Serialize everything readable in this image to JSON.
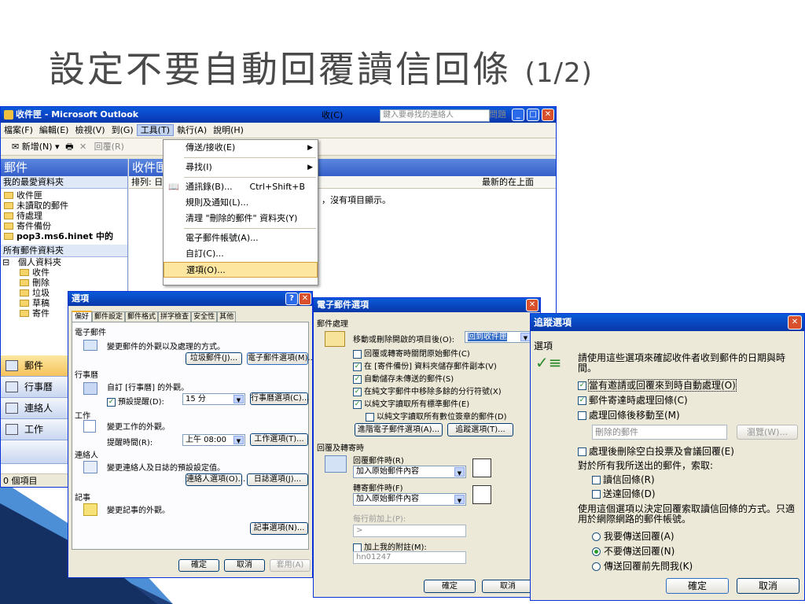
{
  "slide": {
    "title": "設定不要自動回覆讀信回條",
    "title_num": "(1/2)"
  },
  "outlook": {
    "title": "收件匣 - Microsoft Outlook",
    "menubar": [
      "檔案(F)",
      "編輯(E)",
      "檢視(V)",
      "到(G)",
      "工具(T)",
      "執行(A)",
      "說明(H)"
    ],
    "help_box": "輸入需要解答的問題",
    "toolbar": {
      "new": "新增(N)",
      "reply": "回覆(R)",
      "sendrecv": "收(C)",
      "contact_search": "鍵入要尋找的連絡人"
    },
    "nav_title": "郵件",
    "favorites": "我的最愛資料夾",
    "fav_items": [
      "收件匣",
      "未讀取的郵件",
      "待處理",
      "寄件備份",
      "pop3.ms6.hinet 中的 "
    ],
    "all_folders": "所有郵件資料夾",
    "personal": "個人資料夾",
    "sub_items": [
      "收件",
      "刪除",
      "垃圾",
      "草稿",
      "寄件"
    ],
    "nav_buttons": [
      "郵件",
      "行事曆",
      "連絡人",
      "工作"
    ],
    "status": "0 個項目",
    "pane_title": "收件匣",
    "arrange": "排列: 日",
    "newest": "最新的在上面",
    "empty_msg": "，沒有項目顯示。"
  },
  "tools_menu": [
    {
      "label": "傳送/接收(E)",
      "arrow": true
    },
    {
      "label": "尋找(I)",
      "arrow": true
    },
    {
      "label": "通訊錄(B)...",
      "shortcut": "Ctrl+Shift+B"
    },
    {
      "label": "規則及通知(L)..."
    },
    {
      "label": "清理 \"刪除的郵件\" 資料夾(Y)"
    },
    {
      "label": "電子郵件帳號(A)..."
    },
    {
      "label": "自訂(C)..."
    },
    {
      "label": "選項(O)...",
      "selected": true
    }
  ],
  "options_dlg": {
    "title": "選項",
    "tabs": [
      "偏好",
      "郵件設定",
      "郵件格式",
      "拼字檢查",
      "安全性",
      "其他"
    ],
    "mail_group": "電子郵件",
    "mail_desc": "變更郵件的外觀以及處理的方式。",
    "junk_btn": "垃圾郵件(J)...",
    "email_opts_btn": "電子郵件選項(M)...",
    "cal_group": "行事曆",
    "cal_desc": "自訂 [行事曆] 的外觀。",
    "reminder_label": "預設提醒(D):",
    "reminder_val": "15 分",
    "cal_opts_btn": "行事曆選項(C)...",
    "task_group": "工作",
    "task_desc": "變更工作的外觀。",
    "remind_time_label": "提醒時間(R):",
    "remind_time_val": "上午 08:00",
    "task_opts_btn": "工作選項(T)...",
    "contacts_group": "連絡人",
    "contacts_desc": "變更連絡人及日誌的預設設定值。",
    "contact_opts_btn": "連絡人選項(O)...",
    "journal_btn": "日誌選項(J)...",
    "notes_group": "記事",
    "notes_desc": "變更記事的外觀。",
    "notes_btn": "記事選項(N)...",
    "ok": "確定",
    "cancel": "取消",
    "apply": "套用(A)"
  },
  "email_dlg": {
    "title": "電子郵件選項",
    "handling_group": "郵件處理",
    "after_move_label": "移動或刪除開啟的項目後(O):",
    "after_move_val": "回到收件匣",
    "checks": [
      {
        "label": "回覆或轉寄時關閉原始郵件(C)",
        "checked": false
      },
      {
        "label": "在 [寄件備份] 資料夾儲存郵件副本(V)",
        "checked": true
      },
      {
        "label": "自動儲存未傳送的郵件(S)",
        "checked": true
      },
      {
        "label": "在純文字郵件中移除多餘的分行符號(X)",
        "checked": true
      },
      {
        "label": "以純文字讀取所有標準郵件(E)",
        "checked": true
      },
      {
        "label": "以純文字讀取所有數位簽章的郵件(D)",
        "checked": false
      }
    ],
    "adv_btn": "進階電子郵件選項(A)...",
    "track_btn": "追蹤選項(T)...",
    "reply_group": "回覆及轉寄時",
    "reply_label": "回覆郵件時(R)",
    "reply_val": "加入原始郵件內容",
    "fwd_label": "轉寄郵件時(F)",
    "fwd_val": "加入原始郵件內容",
    "prefix_label": "每行前加上(P):",
    "prefix_val": ">",
    "mark_label": "加上我的附註(M):",
    "mark_val": "hn01247",
    "ok": "確定",
    "cancel": "取消"
  },
  "track_dlg": {
    "title": "追蹤選項",
    "group": "選項",
    "desc": "請使用這些選項來確認收件者收到郵件的日期與時間。",
    "checks": [
      {
        "label": "當有邀請或回覆來到時自動處理(O)",
        "checked": true,
        "focus": true
      },
      {
        "label": "郵件寄達時處理回條(C)",
        "checked": true
      },
      {
        "label": "處理回條後移動至(M)",
        "checked": false
      }
    ],
    "folder_val": "刪除的郵件",
    "browse_btn": "瀏覽(W)...",
    "delete_blank": "處理後刪除空白投票及會議回覆(E)",
    "request_label": "對於所有我所送出的郵件，索取:",
    "read_receipt": "讀信回條(R)",
    "delivery_receipt": "送達回條(D)",
    "usage_desc": "使用這個選項以決定回覆索取讀信回條的方式。只適用於網際網路的郵件帳號。",
    "radios": [
      {
        "label": "我要傳送回覆(A)",
        "on": false
      },
      {
        "label": "不要傳送回覆(N)",
        "on": true
      },
      {
        "label": "傳送回覆前先問我(K)",
        "on": false
      }
    ],
    "ok": "確定",
    "cancel": "取消"
  },
  "colors": {
    "xp_title": "#0a4fd0",
    "accent": "#316ac5"
  }
}
